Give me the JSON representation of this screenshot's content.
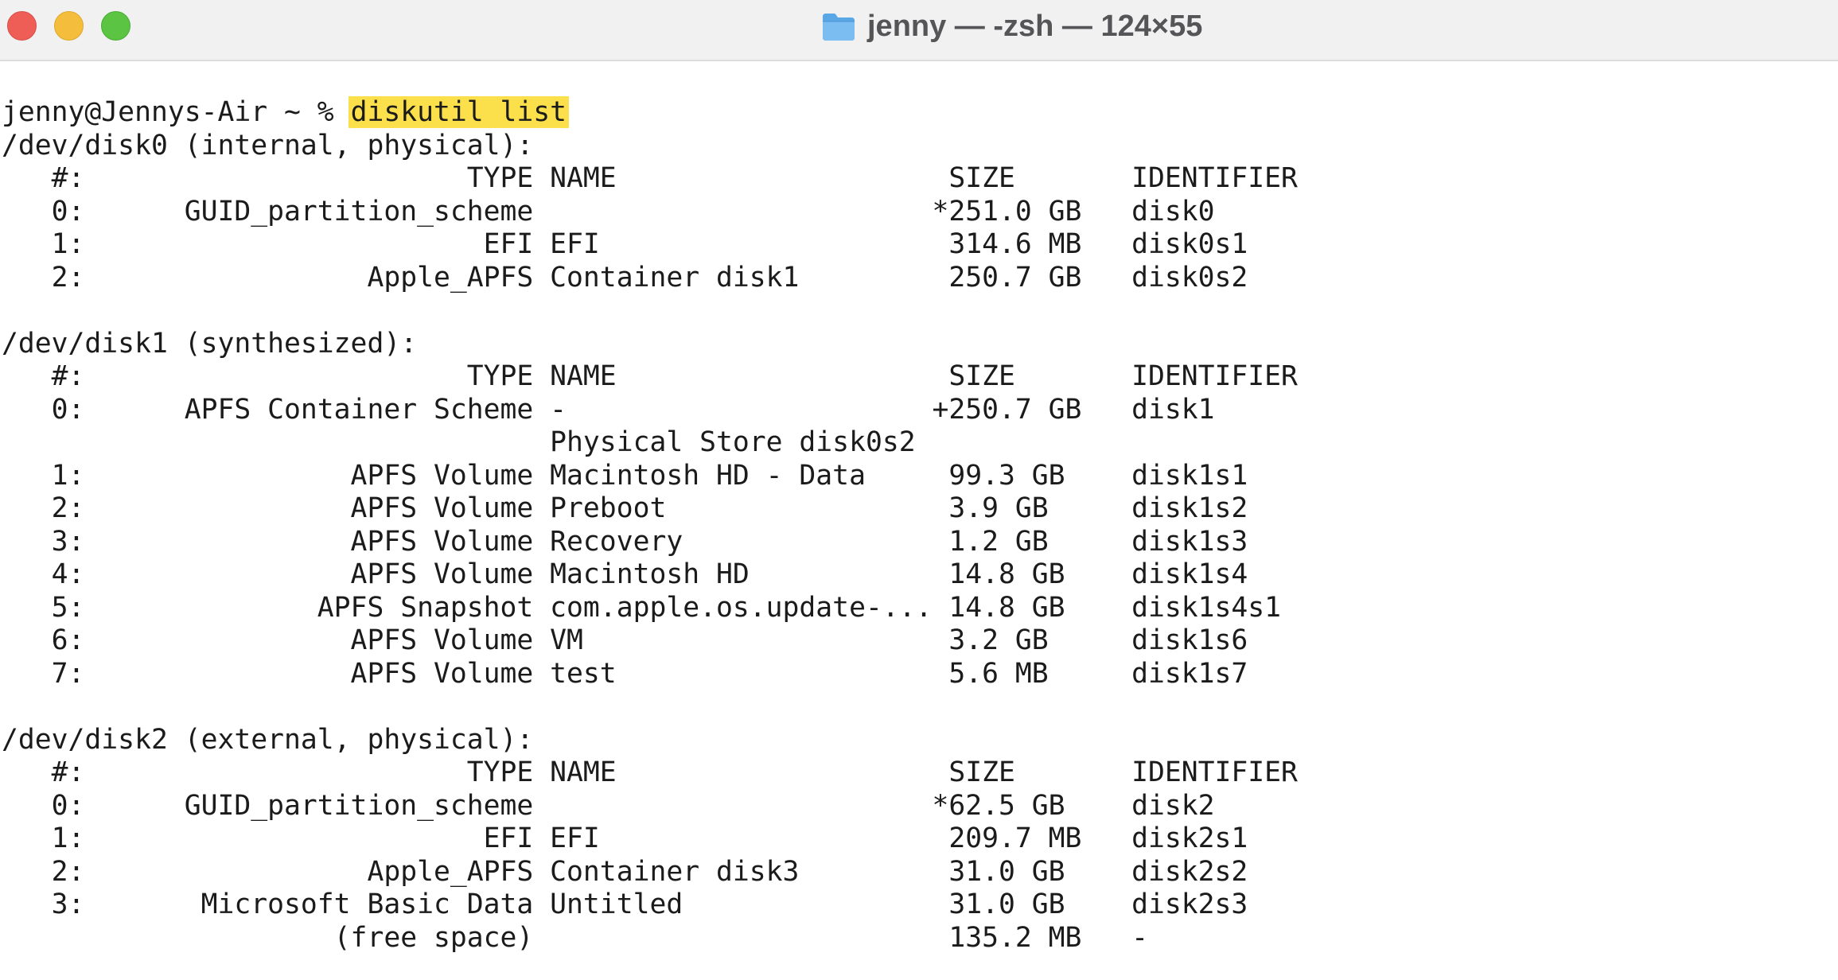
{
  "window": {
    "title": "jenny — -zsh — 124×55"
  },
  "terminal": {
    "prompt": "jenny@Jennys-Air ~ % ",
    "command": "diskutil list",
    "lines": [
      "/dev/disk0 (internal, physical):",
      "   #:                       TYPE NAME                    SIZE       IDENTIFIER",
      "   0:      GUID_partition_scheme                        *251.0 GB   disk0",
      "   1:                        EFI EFI                     314.6 MB   disk0s1",
      "   2:                 Apple_APFS Container disk1         250.7 GB   disk0s2",
      "",
      "/dev/disk1 (synthesized):",
      "   #:                       TYPE NAME                    SIZE       IDENTIFIER",
      "   0:      APFS Container Scheme -                      +250.7 GB   disk1",
      "                                 Physical Store disk0s2",
      "   1:                APFS Volume Macintosh HD - Data     99.3 GB    disk1s1",
      "   2:                APFS Volume Preboot                 3.9 GB     disk1s2",
      "   3:                APFS Volume Recovery                1.2 GB     disk1s3",
      "   4:                APFS Volume Macintosh HD            14.8 GB    disk1s4",
      "   5:              APFS Snapshot com.apple.os.update-... 14.8 GB    disk1s4s1",
      "   6:                APFS Volume VM                      3.2 GB     disk1s6",
      "   7:                APFS Volume test                    5.6 MB     disk1s7",
      "",
      "/dev/disk2 (external, physical):",
      "   #:                       TYPE NAME                    SIZE       IDENTIFIER",
      "   0:      GUID_partition_scheme                        *62.5 GB    disk2",
      "   1:                        EFI EFI                     209.7 MB   disk2s1",
      "   2:                 Apple_APFS Container disk3         31.0 GB    disk2s2",
      "   3:       Microsoft Basic Data Untitled                31.0 GB    disk2s3",
      "                    (free space)                         135.2 MB   -"
    ]
  },
  "colors": {
    "command_highlight": "#fbe04c",
    "close": "#ee5e57",
    "minimize": "#f4bd3c",
    "maximize": "#5bc443",
    "folder": "#5aa7e6"
  },
  "icons": {
    "title": "folder-icon"
  }
}
